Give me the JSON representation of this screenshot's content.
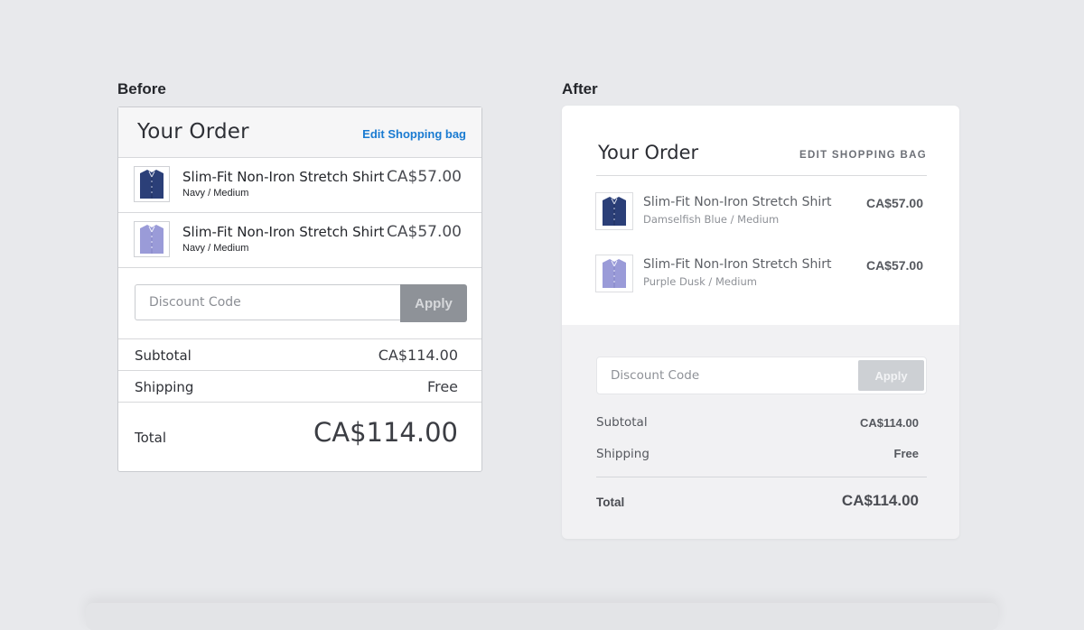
{
  "before": {
    "label": "Before",
    "title": "Your Order",
    "edit_link": "Edit Shopping bag",
    "items": [
      {
        "name": "Slim-Fit Non-Iron Stretch Shirt",
        "variant": "Navy / Medium",
        "price": "CA$57.00",
        "thumb_icon": "navy-shirt-icon",
        "color": "#2b3f78"
      },
      {
        "name": "Slim-Fit Non-Iron Stretch Shirt",
        "variant": "Navy / Medium",
        "price": "CA$57.00",
        "thumb_icon": "purple-shirt-icon",
        "color": "#9a9bd8"
      }
    ],
    "discount": {
      "placeholder": "Discount Code",
      "apply_label": "Apply"
    },
    "subtotal": {
      "label": "Subtotal",
      "value": "CA$114.00"
    },
    "shipping": {
      "label": "Shipping",
      "value": "Free"
    },
    "total": {
      "label": "Total",
      "value": "CA$114.00"
    }
  },
  "after": {
    "label": "After",
    "title": "Your Order",
    "edit_link": "EDIT SHOPPING BAG",
    "items": [
      {
        "name": "Slim-Fit Non-Iron Stretch Shirt",
        "variant": "Damselfish Blue / Medium",
        "price": "CA$57.00",
        "thumb_icon": "navy-shirt-icon",
        "color": "#2b3f78"
      },
      {
        "name": "Slim-Fit Non-Iron Stretch Shirt",
        "variant": "Purple Dusk / Medium",
        "price": "CA$57.00",
        "thumb_icon": "purple-shirt-icon",
        "color": "#9a9bd8"
      }
    ],
    "discount": {
      "placeholder": "Discount Code",
      "apply_label": "Apply"
    },
    "subtotal": {
      "label": "Subtotal",
      "value": "CA$114.00"
    },
    "shipping": {
      "label": "Shipping",
      "value": "Free"
    },
    "total": {
      "label": "Total",
      "value": "CA$114.00"
    }
  },
  "colors": {
    "background": "#e8e9ec",
    "link_blue": "#1a7bd1",
    "apply_before": "#8e9298",
    "apply_after": "#cdd0d4"
  }
}
